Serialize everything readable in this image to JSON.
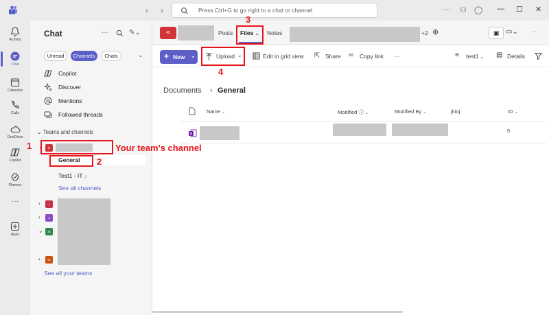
{
  "titlebar": {
    "search_placeholder": "Press Ctrl+G to go right to a chat or channel"
  },
  "rail": {
    "items": [
      {
        "label": "Activity",
        "icon": "bell-icon"
      },
      {
        "label": "Chat",
        "icon": "chat-icon",
        "active": true
      },
      {
        "label": "Calendar",
        "icon": "calendar-icon"
      },
      {
        "label": "Calls",
        "icon": "phone-icon"
      },
      {
        "label": "OneDrive",
        "icon": "cloud-icon"
      },
      {
        "label": "Copilot",
        "icon": "copilot-icon"
      },
      {
        "label": "Planner",
        "icon": "planner-icon"
      },
      {
        "label": "Apps",
        "icon": "apps-icon"
      }
    ],
    "more": "···"
  },
  "chat": {
    "title": "Chat",
    "filters": [
      "Unread",
      "Channels",
      "Chats"
    ],
    "nav": [
      {
        "label": "Copilot",
        "icon": "copilot-icon"
      },
      {
        "label": "Discover",
        "icon": "sparkle-icon"
      },
      {
        "label": "Mentions",
        "icon": "at-icon"
      },
      {
        "label": "Followed threads",
        "icon": "threads-icon"
      }
    ],
    "section_header": "Teams and channels",
    "team_initial": "b",
    "channels": {
      "general": "General",
      "test": "Test1 - IT",
      "see_all": "See all channels"
    },
    "other_team_initials": [
      "i",
      "J",
      "St",
      "sc"
    ],
    "see_all_teams": "See all your teams"
  },
  "main": {
    "team_badge": "Rt",
    "tabs": {
      "posts": "Posts",
      "files": "Files",
      "notes": "Notes",
      "more_count": "+2"
    },
    "toolbar": {
      "new_label": "New",
      "upload_label": "Upload",
      "grid_label": "Edit in grid view",
      "share_label": "Share",
      "copy_link_label": "Copy link",
      "more": "···",
      "view_label": "test1",
      "details_label": "Details"
    },
    "breadcrumb": {
      "root": "Documents",
      "sep": "›",
      "current": "General"
    },
    "table": {
      "headers": {
        "name": "Name",
        "modified": "Modified",
        "modified_by": "Modified By",
        "col4": "jhioj",
        "id": "ID"
      },
      "rows": [
        {
          "id": "5"
        }
      ]
    }
  },
  "annotations": {
    "n1": "1",
    "n2": "2",
    "n3": "3",
    "n4": "4",
    "label1": "Your team's channel"
  },
  "colors": {
    "accent": "#5b5fc7",
    "annotation": "#e8141b"
  }
}
